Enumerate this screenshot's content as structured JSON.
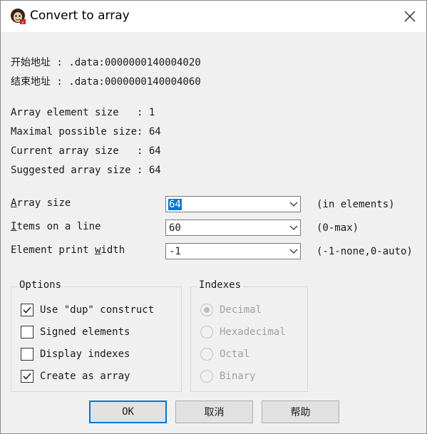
{
  "window": {
    "title": "Convert to array"
  },
  "range": {
    "start_label": "开始地址",
    "start_value": " : .data:0000000140004020",
    "end_label": "结束地址",
    "end_value": " : .data:0000000140004060"
  },
  "info": [
    {
      "label": "Array element size   :",
      "value": "1"
    },
    {
      "label": "Maximal possible size:",
      "value": "64"
    },
    {
      "label": "Current array size   :",
      "value": "64"
    },
    {
      "label": "Suggested array size :",
      "value": "64"
    }
  ],
  "fields": {
    "array_size": {
      "label_mnemonic": "A",
      "label_rest": "rray size",
      "value": "64",
      "hint": "(in elements)"
    },
    "items_on_line": {
      "label_mnemonic": "I",
      "label_rest": "tems on a line",
      "value": "60",
      "hint": "(0-max)"
    },
    "element_print_width": {
      "label_pre": "Element print ",
      "label_mnemonic": "w",
      "label_rest": "idth",
      "value": "-1",
      "hint": "(-1-none,0-auto)"
    }
  },
  "options": {
    "title": "Options",
    "items": [
      {
        "label": "Use \"dup\" construct",
        "checked": true
      },
      {
        "label": "Signed elements",
        "checked": false
      },
      {
        "label": "Display indexes",
        "checked": false
      },
      {
        "label": "Create as array",
        "checked": true
      }
    ]
  },
  "indexes": {
    "title": "Indexes",
    "items": [
      {
        "label": "Decimal",
        "selected": true
      },
      {
        "label": "Hexadecimal",
        "selected": false
      },
      {
        "label": "Octal",
        "selected": false
      },
      {
        "label": "Binary",
        "selected": false
      }
    ]
  },
  "buttons": {
    "ok": "OK",
    "cancel": "取消",
    "help": "帮助"
  },
  "colors": {
    "accent": "#0078d7",
    "background": "#f0f0f0",
    "disabled_text": "#a0a0a0"
  },
  "icons": {
    "app": "ida-app-icon",
    "close": "close-icon",
    "dropdown": "chevron-down-icon",
    "check": "check-icon"
  }
}
